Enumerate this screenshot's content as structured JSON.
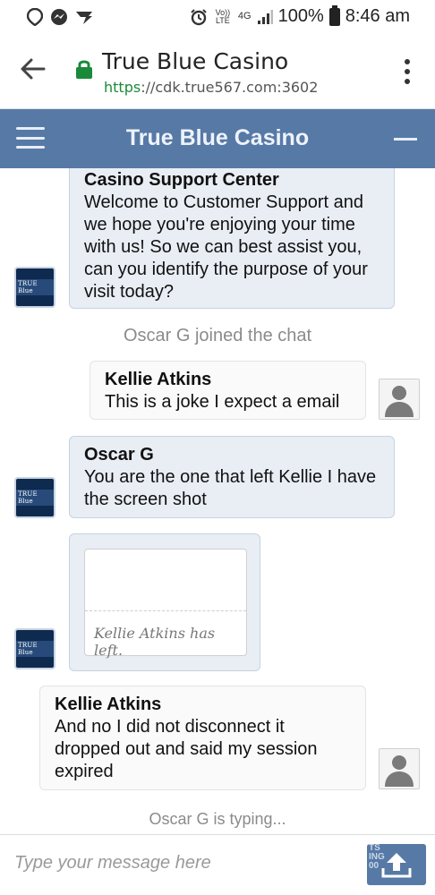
{
  "status_bar": {
    "volte": "Vo)) LTE",
    "network": "4G",
    "battery": "100%",
    "time": "8:46 am"
  },
  "browser": {
    "title": "True Blue Casino",
    "url_scheme": "https",
    "url_rest": "://cdk.true567.com:3602"
  },
  "chat_header": {
    "title": "True Blue Casino"
  },
  "messages": [
    {
      "sender": "Casino Support Center",
      "text": "Welcome to Customer Support and we hope you're enjoying your time with us! So we can best assist you, can you identify the purpose of your visit today?"
    },
    {
      "sender": "Kellie Atkins",
      "text": "This is a joke I expect a email"
    },
    {
      "sender": "Oscar G",
      "text": "You are the one that left Kellie I have the screen shot"
    },
    {
      "sender": "Kellie Atkins",
      "text": "And no I did not disconnect it dropped out and said my session expired"
    }
  ],
  "system": {
    "joined": "Oscar G joined the chat",
    "left": "Kellie Atkins has left.",
    "typing": "Oscar G is typing..."
  },
  "avatar_logo_text": "TRUE Blue",
  "input": {
    "placeholder": "Type your message here"
  },
  "send_button_ghost_text": "TS ING 00",
  "colors": {
    "header": "#5779a6",
    "agent_bubble": "#e9eef5",
    "user_bubble": "#fafafa",
    "secure": "#1a8a3a"
  },
  "icons": {
    "back": "arrow-left",
    "lock": "lock",
    "menu": "hamburger",
    "more": "kebab-vertical",
    "minimize": "minus",
    "send": "upload-tray"
  }
}
